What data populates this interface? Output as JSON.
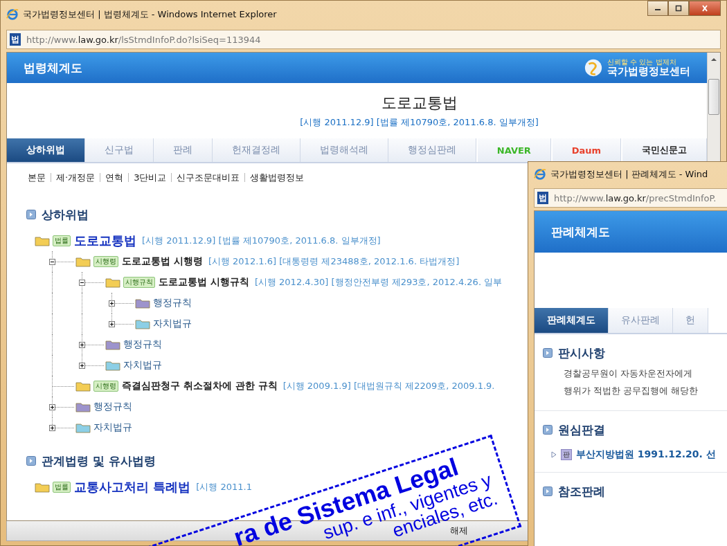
{
  "main_window": {
    "title": "국가법령정보센터 | 법령체계도 - Windows Internet Explorer",
    "address_prefix": "http://www.",
    "address_domain": "law.go.kr",
    "address_path": "/lsStmdInfoP.do?lsiSeq=113944",
    "site_badge": "법",
    "header_title": "법령체계도",
    "logo_tagline": "신뢰할 수 있는 법제처",
    "logo_name": "국가법령정보센터",
    "law_title": "도로교통법",
    "law_subtitle": "[시행 2011.12.9] [법률 제10790호, 2011.6.8. 일부개정]",
    "tabs": [
      {
        "label": "상하위법",
        "kind": "text",
        "selected": true
      },
      {
        "label": "신구법",
        "kind": "text",
        "selected": false
      },
      {
        "label": "판례",
        "kind": "text",
        "selected": false
      },
      {
        "label": "헌재결정례",
        "kind": "text",
        "selected": false
      },
      {
        "label": "법령해석례",
        "kind": "text",
        "selected": false
      },
      {
        "label": "행정심판례",
        "kind": "text",
        "selected": false
      },
      {
        "label": "NAVER",
        "kind": "logo",
        "color": "#3cb728",
        "selected": false
      },
      {
        "label": "Daum",
        "kind": "logo",
        "color": "#e8412c",
        "selected": false
      },
      {
        "label": "국민신문고",
        "kind": "logo",
        "color": "#222222",
        "selected": false
      }
    ],
    "subnav": [
      "본문",
      "제·개정문",
      "연혁",
      "3단비교",
      "신구조문대비표",
      "생활법령정보"
    ],
    "sections": [
      {
        "title": "상하위법",
        "tree": [
          {
            "kind": "law",
            "tag": "법률",
            "name": "도로교통법",
            "info": "[시행 2011.12.9] [법률 제10790호, 2011.6.8. 일부개정]",
            "children": [
              {
                "kind": "law",
                "tag": "시행령",
                "name": "도로교통법 시행령",
                "info": "[시행 2012.1.6] [대통령령 제23488호, 2012.1.6. 타법개정]",
                "expanded": true,
                "children": [
                  {
                    "kind": "law",
                    "tag": "시행규칙",
                    "name": "도로교통법 시행규칙",
                    "info": "[시행 2012.4.30] [행정안전부령 제293호, 2012.4.26. 일부",
                    "expanded": true,
                    "children": [
                      {
                        "kind": "folder",
                        "name": "행정규칙",
                        "color": "#9d93cc",
                        "expanded": false
                      },
                      {
                        "kind": "folder",
                        "name": "자치법규",
                        "color": "#8ccfe6",
                        "expanded": false
                      }
                    ]
                  },
                  {
                    "kind": "folder",
                    "name": "행정규칙",
                    "color": "#9d93cc",
                    "expanded": false
                  },
                  {
                    "kind": "folder",
                    "name": "자치법규",
                    "color": "#8ccfe6",
                    "expanded": false
                  }
                ]
              },
              {
                "kind": "law",
                "tag": "시행령",
                "name": "즉결심판청구 취소절차에 관한 규칙",
                "info": "[시행 2009.1.9] [대법원규칙 제2209호, 2009.1.9."
              },
              {
                "kind": "folder",
                "name": "행정규칙",
                "color": "#9d93cc",
                "expanded": false
              },
              {
                "kind": "folder",
                "name": "자치법규",
                "color": "#8ccfe6",
                "expanded": false
              }
            ]
          }
        ]
      },
      {
        "title": "관계법령 및 유사법령",
        "tree": [
          {
            "kind": "law",
            "tag": "법률",
            "name": "교통사고처리 특례법",
            "info": "[시행 2011.1"
          }
        ]
      }
    ],
    "status": "해제"
  },
  "popup_window": {
    "title": "국가법령정보센터 | 판례체계도 - Wind",
    "address_prefix": "http://www.",
    "address_domain": "law.go.kr",
    "address_path": "/precStmdInfoP.",
    "site_badge": "법",
    "header_title": "판례체계도",
    "tabs": [
      {
        "label": "판례체계도",
        "selected": true
      },
      {
        "label": "유사판례",
        "selected": false
      },
      {
        "label": "헌",
        "selected": false
      }
    ],
    "sections": [
      {
        "kind": "text",
        "title": "판시사항",
        "lines": [
          "경찰공무원이 자동차운전자에게",
          "행위가 적법한 공무집행에 해당한"
        ]
      },
      {
        "kind": "link",
        "title": "원심판결",
        "tag": "판",
        "link": "부산지방법원 1991.12.20. 선"
      },
      {
        "kind": "empty",
        "title": "참조판례"
      }
    ]
  },
  "annotation": {
    "lines": [
      "ra de Sistema Legal",
      "sup. e inf., vigentes y",
      "enciales, etc."
    ]
  }
}
